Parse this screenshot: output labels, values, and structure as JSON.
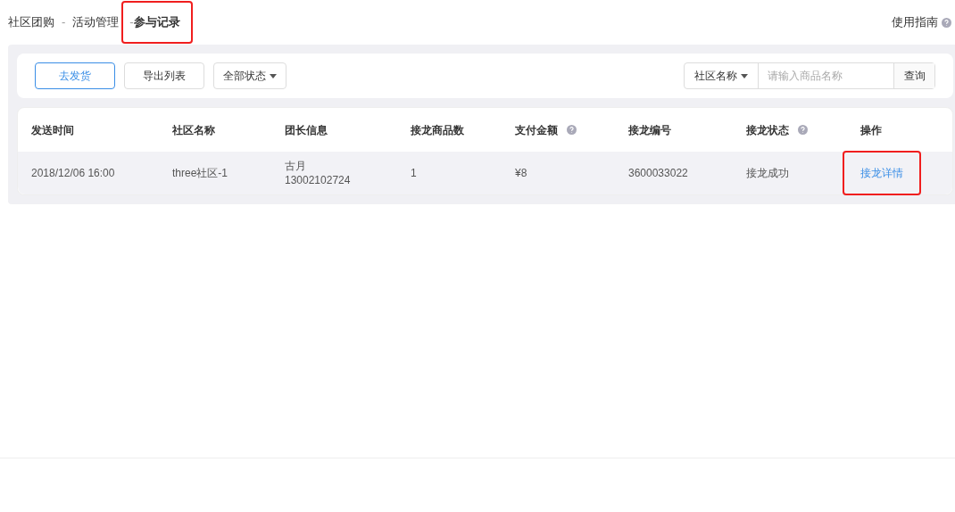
{
  "breadcrumb": [
    {
      "label": "社区团购",
      "separator": "-",
      "highlighted": false
    },
    {
      "label": "活动管理",
      "separator": "-",
      "highlighted": false
    },
    {
      "label": "参与记录",
      "highlighted": true
    }
  ],
  "help_link": {
    "label": "使用指南",
    "help_icon": true
  },
  "toolbar": {
    "buttons": [
      {
        "label": "去发货",
        "kind": "primary"
      },
      {
        "label": "导出列表",
        "kind": "default"
      },
      {
        "label": "全部状态",
        "kind": "dropdown"
      }
    ],
    "search": {
      "scope": "社区名称",
      "placeholder": "请输入商品名称",
      "button": "查询"
    }
  },
  "table": {
    "columns": [
      {
        "label": "发送时间",
        "help_icon": false
      },
      {
        "label": "社区名称",
        "help_icon": false
      },
      {
        "label": "团长信息",
        "help_icon": false
      },
      {
        "label": "接龙商品数",
        "help_icon": false
      },
      {
        "label": "支付金额",
        "help_icon": true
      },
      {
        "label": "接龙编号",
        "help_icon": false
      },
      {
        "label": "接龙状态",
        "help_icon": true
      },
      {
        "label": "操作",
        "help_icon": false
      }
    ],
    "rows": [
      {
        "cells": [
          [
            "2018/12/06 16:00"
          ],
          [
            "three社区-1"
          ],
          [
            "古月",
            "13002102724"
          ],
          [
            "1"
          ],
          [
            "¥8"
          ],
          [
            "3600033022"
          ],
          [
            "接龙成功"
          ]
        ],
        "action": {
          "label": "接龙详情",
          "highlighted": true
        }
      }
    ]
  }
}
